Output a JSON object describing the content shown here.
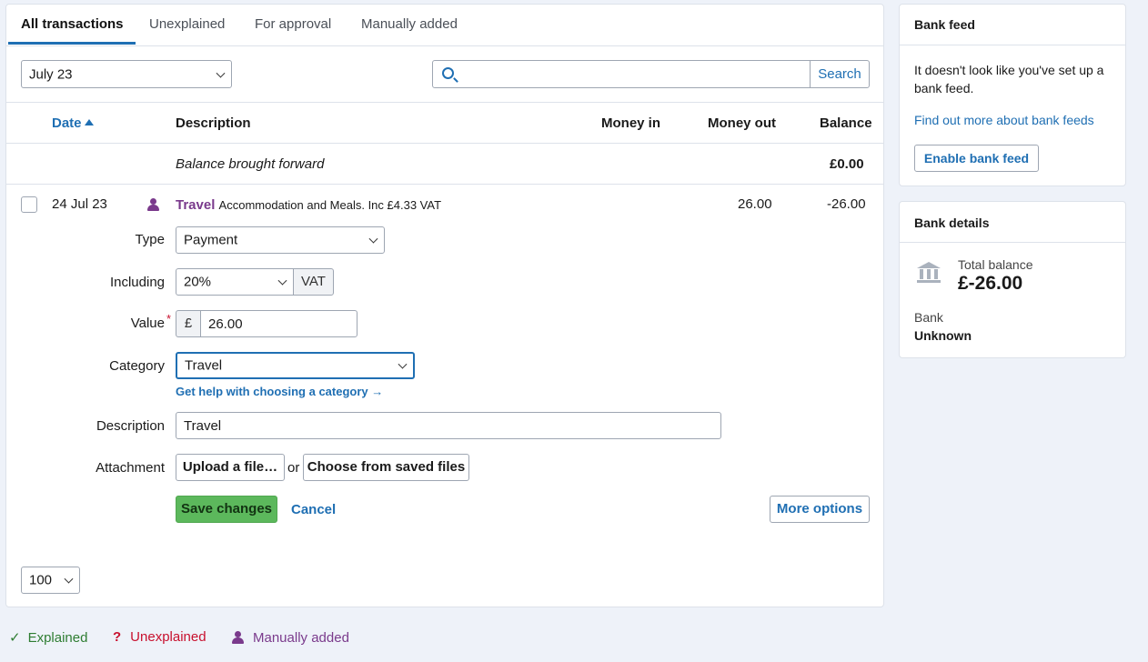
{
  "tabs": [
    {
      "label": "All transactions",
      "active": true
    },
    {
      "label": "Unexplained",
      "active": false
    },
    {
      "label": "For approval",
      "active": false
    },
    {
      "label": "Manually added",
      "active": false
    }
  ],
  "filter": {
    "month": "July 23",
    "search_value": "",
    "search_button": "Search"
  },
  "table": {
    "headers": {
      "date": "Date",
      "description": "Description",
      "money_in": "Money in",
      "money_out": "Money out",
      "balance": "Balance"
    },
    "balance_forward": {
      "label": "Balance brought forward",
      "balance": "£0.00"
    },
    "row": {
      "date": "24 Jul 23",
      "category": "Travel",
      "detail": "Accommodation and Meals. Inc £4.33 VAT",
      "money_in": "",
      "money_out": "26.00",
      "balance": "-26.00"
    }
  },
  "form": {
    "type_label": "Type",
    "type_value": "Payment",
    "including_label": "Including",
    "including_value": "20%",
    "vat_addon": "VAT",
    "value_label": "Value",
    "required_mark": "*",
    "currency_addon": "£",
    "value": "26.00",
    "category_label": "Category",
    "category_value": "Travel",
    "category_help": "Get help with choosing a category →",
    "description_label": "Description",
    "description_value": "Travel",
    "attachment_label": "Attachment",
    "upload_button": "Upload a file…",
    "or_text": "or",
    "choose_button": "Choose from saved files",
    "save_button": "Save changes",
    "cancel_link": "Cancel",
    "more_options_button": "More options"
  },
  "pagination": {
    "per_page": "100"
  },
  "bank_feed": {
    "title": "Bank feed",
    "message": "It doesn't look like you've set up a bank feed.",
    "link": "Find out more about bank feeds",
    "button": "Enable bank feed"
  },
  "bank_details": {
    "title": "Bank details",
    "total_label": "Total balance",
    "total_value": "£-26.00",
    "bank_label": "Bank",
    "bank_value": "Unknown"
  },
  "legend": {
    "explained": "Explained",
    "unexplained": "Unexplained",
    "manually_added": "Manually added"
  },
  "colors": {
    "accent": "#1f6fb3",
    "explained": "#2e7d32",
    "unexplained": "#c8102e",
    "manual": "#7a3a8c",
    "save": "#5cb85c"
  },
  "icons": [
    "search-icon",
    "sort-ascending-icon",
    "chevron-down-icon",
    "person-icon",
    "bank-icon",
    "checkmark-icon",
    "question-mark-icon"
  ]
}
